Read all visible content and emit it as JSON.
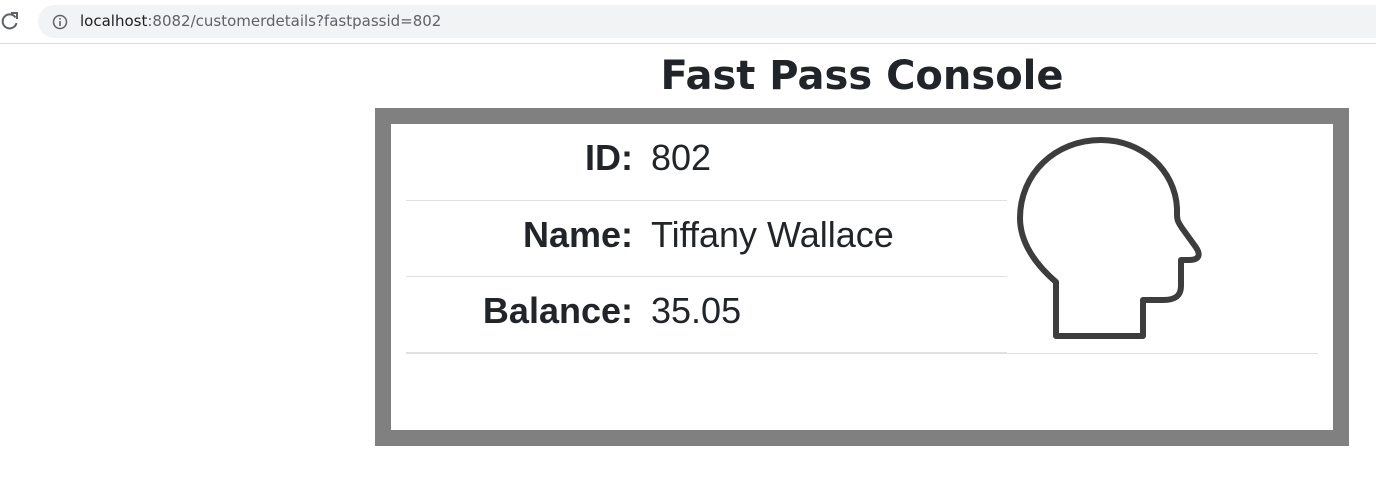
{
  "browser": {
    "url_host": "localhost",
    "url_rest": ":8082/customerdetails?fastpassid=802"
  },
  "page": {
    "title": "Fast Pass Console"
  },
  "customer": {
    "rows": [
      {
        "label": "ID:",
        "value": "802"
      },
      {
        "label": "Name:",
        "value": "Tiffany Wallace"
      },
      {
        "label": "Balance:",
        "value": "35.05"
      }
    ],
    "avatar_icon": "head-profile-icon"
  },
  "colors": {
    "frame": "#808080",
    "text": "#212529",
    "divider": "#dee2e6"
  }
}
